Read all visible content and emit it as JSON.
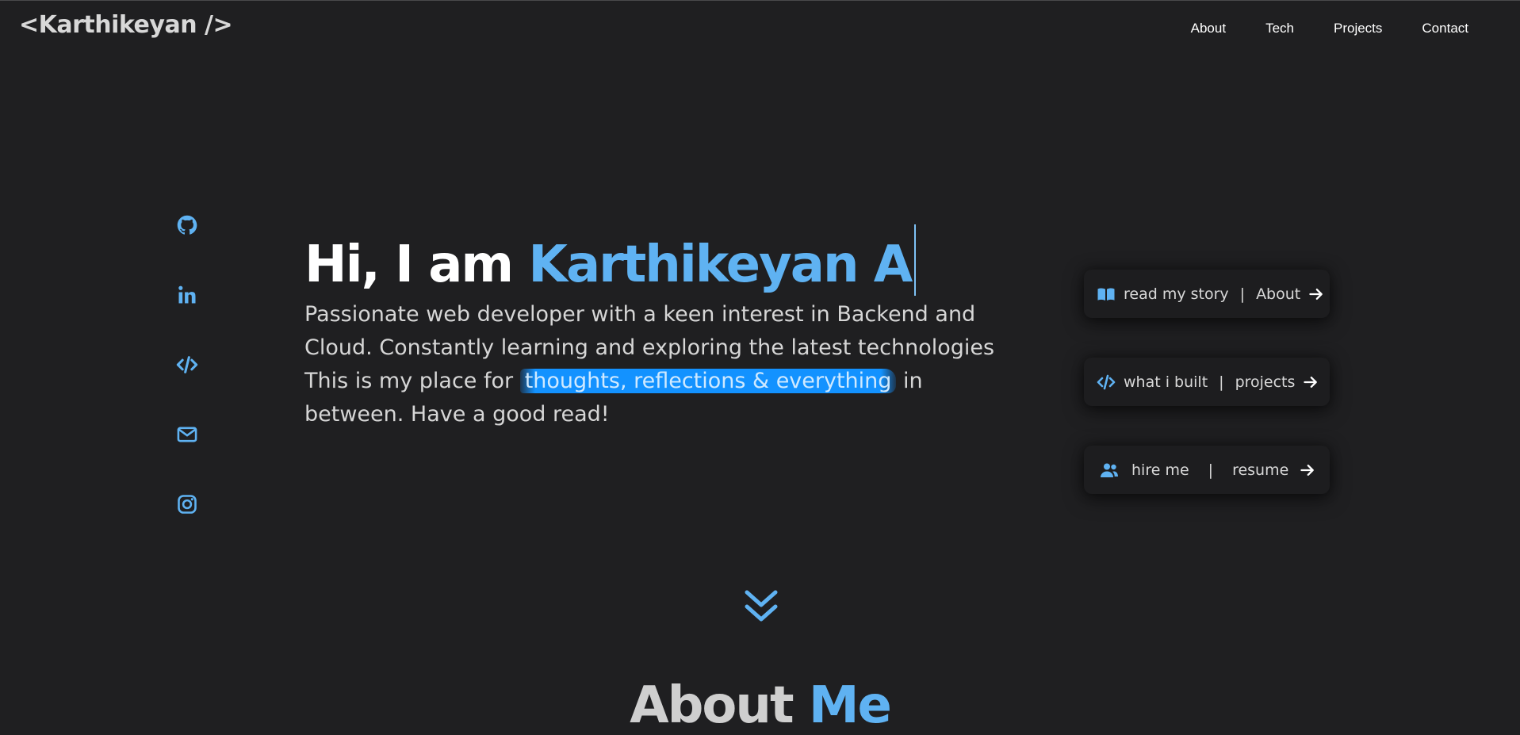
{
  "header": {
    "logo": "<Karthikeyan />",
    "nav": [
      "About",
      "Tech",
      "Projects",
      "Contact"
    ]
  },
  "social": [
    "github-icon",
    "linkedin-icon",
    "code-icon",
    "mail-icon",
    "instagram-icon"
  ],
  "hero": {
    "greeting": "Hi, I am",
    "name": "Karthikeyan A",
    "line1": "Passionate web developer with a keen interest in Backend and Cloud. Constantly learning and exploring the latest technologies",
    "line2_before": "This is my place for ",
    "line2_highlight": "thoughts, reflections & everything",
    "line2_after": " in between. Have a good read!"
  },
  "cards": [
    {
      "icon": "book-icon",
      "label": "read my story",
      "link": "About"
    },
    {
      "icon": "code-icon",
      "label": "what i built",
      "link": "projects"
    },
    {
      "icon": "users-icon",
      "label": "hire me",
      "link": "resume"
    }
  ],
  "card_separator": "|",
  "about": {
    "word1": "About",
    "word2": "Me"
  },
  "colors": {
    "background": "#1f1f21",
    "accent": "#5fb2f2",
    "highlight": "#1392ff"
  }
}
